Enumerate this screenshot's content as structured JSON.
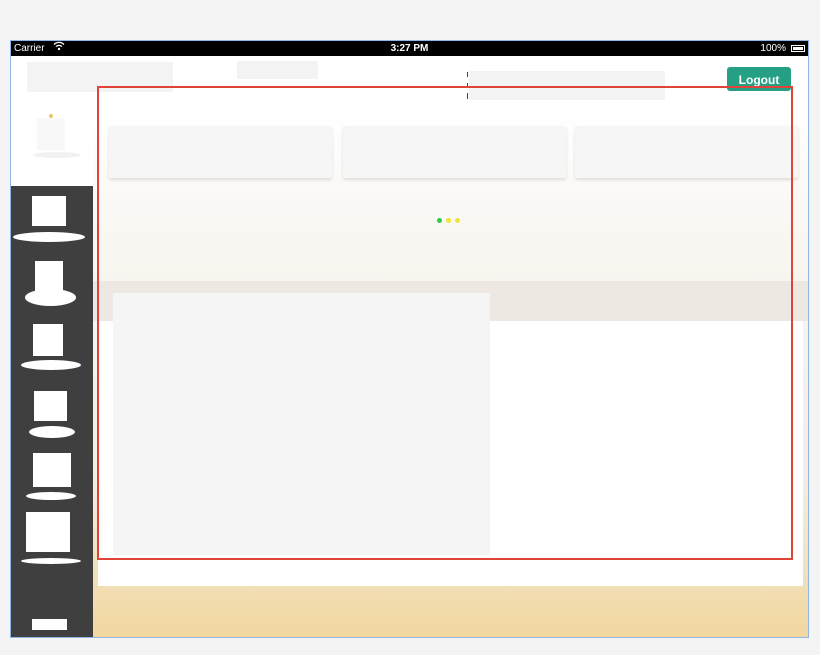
{
  "status_bar": {
    "carrier": "Carrier",
    "wifi_icon": "wifi-icon",
    "time": "3:27 PM",
    "battery": "100%",
    "battery_icon": "battery-icon"
  },
  "header": {
    "logout_label": "Logout"
  },
  "colors": {
    "logout_button": "#26a085",
    "highlight_border": "#e0433a",
    "sidebar_bg": "#3f3f40",
    "loading_dot_1": "#2ecc40",
    "loading_dot_2": "#f1e33a",
    "loading_dot_3": "#f1e33a"
  },
  "sidebar": {
    "items": [
      {
        "icon": "nav-icon-1"
      },
      {
        "icon": "nav-icon-2"
      },
      {
        "icon": "nav-icon-3"
      },
      {
        "icon": "nav-icon-4"
      },
      {
        "icon": "nav-icon-5"
      },
      {
        "icon": "nav-icon-6"
      },
      {
        "icon": "nav-icon-7"
      }
    ]
  }
}
